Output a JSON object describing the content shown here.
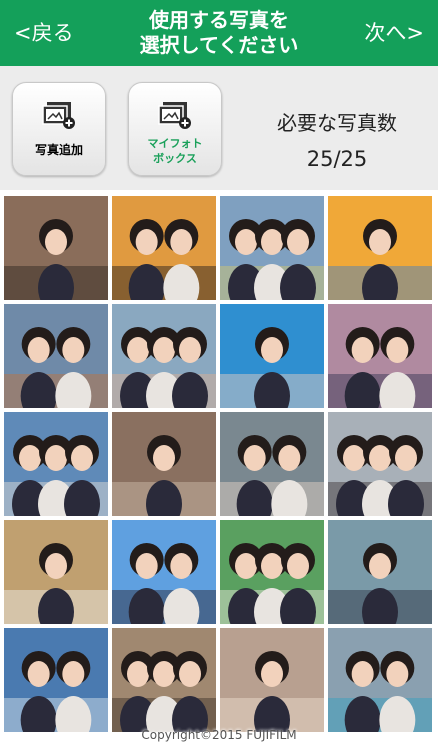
{
  "header": {
    "back_label": "<戻る",
    "next_label": "次へ>",
    "title_line1": "使用する写真を",
    "title_line2": "選択してください"
  },
  "toolbar": {
    "add_photo_label": "写真追加",
    "mybox_label_line1": "マイフォト",
    "mybox_label_line2": "ボックス",
    "count_label": "必要な写真数",
    "count_value": "25/25"
  },
  "photos": [
    {
      "bg": "#8a6d5a",
      "accent": "#2b2420"
    },
    {
      "bg": "#e09a40",
      "accent": "#1c1a1c"
    },
    {
      "bg": "#7fa0c0",
      "accent": "#d8c86a"
    },
    {
      "bg": "#f0a838",
      "accent": "#3f7fc8"
    },
    {
      "bg": "#6f8aa8",
      "accent": "#c0703a"
    },
    {
      "bg": "#8aa8c0",
      "accent": "#e0b090"
    },
    {
      "bg": "#2f8fd0",
      "accent": "#f0d0c0"
    },
    {
      "bg": "#b08aa0",
      "accent": "#303050"
    },
    {
      "bg": "#5f8ab8",
      "accent": "#e8e0d8"
    },
    {
      "bg": "#8a7060",
      "accent": "#d0c0b0"
    },
    {
      "bg": "#7a8890",
      "accent": "#e8d8c8"
    },
    {
      "bg": "#a8b0b8",
      "accent": "#3a3030"
    },
    {
      "bg": "#c0a070",
      "accent": "#f0f0f0"
    },
    {
      "bg": "#5fa0e0",
      "accent": "#2a2430"
    },
    {
      "bg": "#5aa060",
      "accent": "#f0e8e0"
    },
    {
      "bg": "#7a9aa8",
      "accent": "#2a3040"
    },
    {
      "bg": "#4a7ab0",
      "accent": "#e0e8f0"
    },
    {
      "bg": "#a08870",
      "accent": "#3a3028"
    },
    {
      "bg": "#b8a090",
      "accent": "#f0e0d0"
    },
    {
      "bg": "#8aa0b0",
      "accent": "#30a0c0"
    }
  ],
  "copyright": "Copyright©2015 FUJIFILM"
}
